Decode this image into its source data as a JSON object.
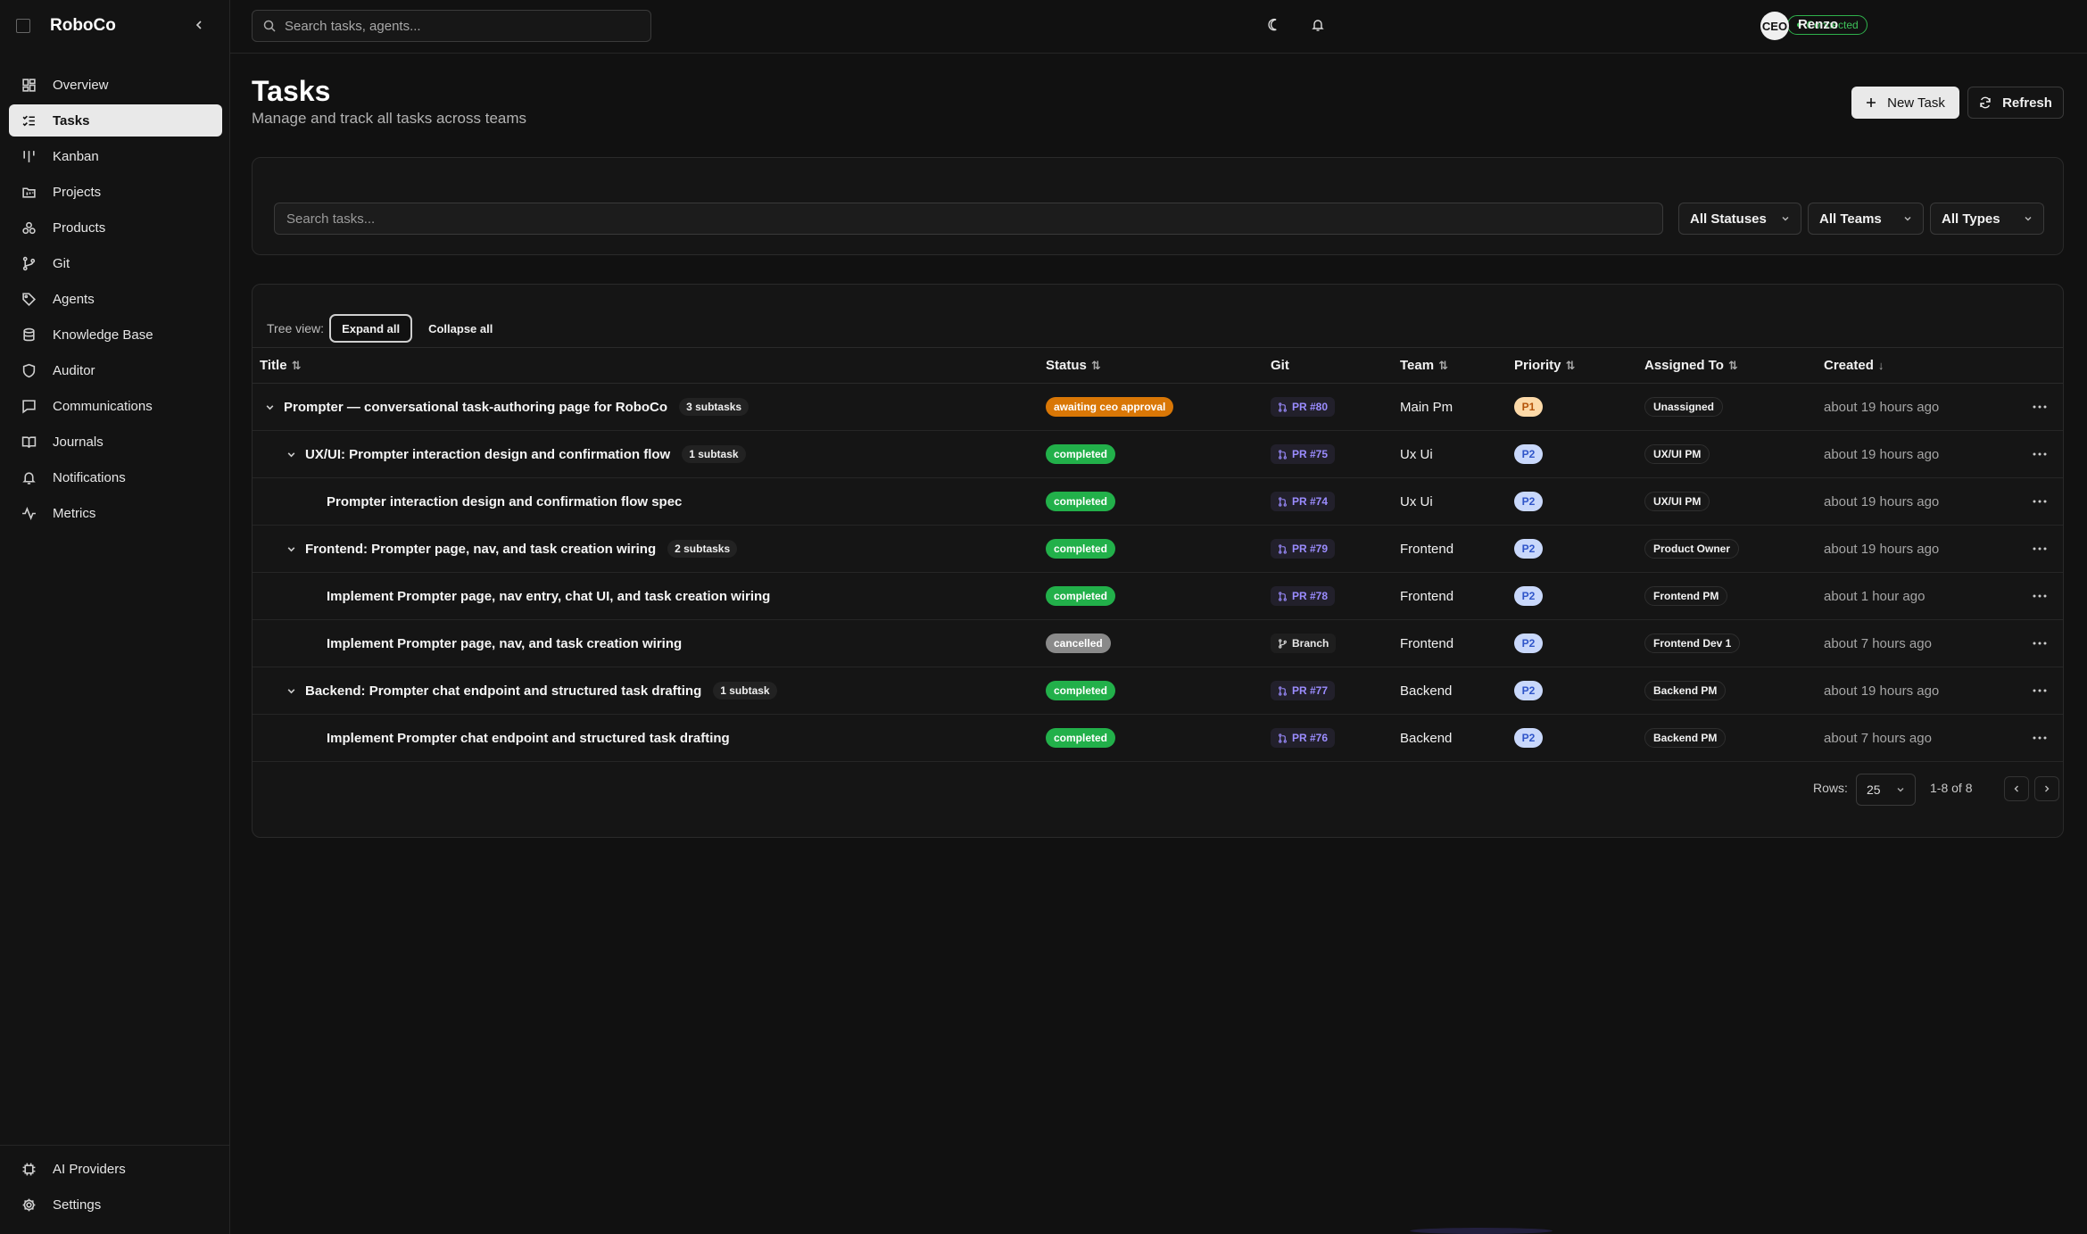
{
  "app": {
    "name": "RoboCo"
  },
  "sidebar": {
    "items": [
      {
        "label": "Overview",
        "icon": "grid-icon",
        "active": false
      },
      {
        "label": "Tasks",
        "icon": "list-checks-icon",
        "active": true
      },
      {
        "label": "Kanban",
        "icon": "kanban-icon",
        "active": false
      },
      {
        "label": "Projects",
        "icon": "folder-kanban-icon",
        "active": false
      },
      {
        "label": "Products",
        "icon": "boxes-icon",
        "active": false
      },
      {
        "label": "Git",
        "icon": "git-branch-icon",
        "active": false
      },
      {
        "label": "Agents",
        "icon": "tag-icon",
        "active": false
      },
      {
        "label": "Knowledge Base",
        "icon": "database-icon",
        "active": false
      },
      {
        "label": "Auditor",
        "icon": "shield-icon",
        "active": false
      },
      {
        "label": "Communications",
        "icon": "message-square-icon",
        "active": false
      },
      {
        "label": "Journals",
        "icon": "book-open-icon",
        "active": false
      },
      {
        "label": "Notifications",
        "icon": "bell-icon",
        "active": false
      },
      {
        "label": "Metrics",
        "icon": "activity-icon",
        "active": false
      }
    ],
    "bottom": [
      {
        "label": "AI Providers",
        "icon": "cpu-icon"
      },
      {
        "label": "Settings",
        "icon": "gear-icon"
      }
    ]
  },
  "header": {
    "search_placeholder": "Search tasks, agents...",
    "connection": "Connected",
    "avatar_initials": "CEO",
    "user_name": "Renzo"
  },
  "page": {
    "title": "Tasks",
    "subtitle": "Manage and track all tasks across teams",
    "new_task_label": "New Task",
    "refresh_label": "Refresh"
  },
  "filters": {
    "search_placeholder": "Search tasks...",
    "status": "All Statuses",
    "team": "All Teams",
    "type": "All Types"
  },
  "tree": {
    "label": "Tree view:",
    "expand": "Expand all",
    "collapse": "Collapse all"
  },
  "columns": {
    "title": "Title",
    "status": "Status",
    "git": "Git",
    "team": "Team",
    "priority": "Priority",
    "assigned": "Assigned To",
    "created": "Created"
  },
  "rows": [
    {
      "title": "Prompter — conversational task-authoring page for RoboCo",
      "subtasks": "3 subtasks",
      "status": "awaiting ceo approval",
      "git": "PR #80",
      "git_type": "pr",
      "team": "Main Pm",
      "priority": "P1",
      "assigned": "Unassigned",
      "created": "about 19 hours ago"
    },
    {
      "title": "UX/UI: Prompter interaction design and confirmation flow",
      "subtasks": "1 subtask",
      "status": "completed",
      "git": "PR #75",
      "git_type": "pr",
      "team": "Ux Ui",
      "priority": "P2",
      "assigned": "UX/UI PM",
      "created": "about 19 hours ago"
    },
    {
      "title": "Prompter interaction design and confirmation flow spec",
      "subtasks": "",
      "status": "completed",
      "git": "PR #74",
      "git_type": "pr",
      "team": "Ux Ui",
      "priority": "P2",
      "assigned": "UX/UI PM",
      "created": "about 19 hours ago"
    },
    {
      "title": "Frontend: Prompter page, nav, and task creation wiring",
      "subtasks": "2 subtasks",
      "status": "completed",
      "git": "PR #79",
      "git_type": "pr",
      "team": "Frontend",
      "priority": "P2",
      "assigned": "Product Owner",
      "created": "about 19 hours ago"
    },
    {
      "title": "Implement Prompter page, nav entry, chat UI, and task creation wiring",
      "subtasks": "",
      "status": "completed",
      "git": "PR #78",
      "git_type": "pr",
      "team": "Frontend",
      "priority": "P2",
      "assigned": "Frontend PM",
      "created": "about 1 hour ago"
    },
    {
      "title": "Implement Prompter page, nav, and task creation wiring",
      "subtasks": "",
      "status": "cancelled",
      "git": "Branch",
      "git_type": "branch",
      "team": "Frontend",
      "priority": "P2",
      "assigned": "Frontend Dev 1",
      "created": "about 7 hours ago"
    },
    {
      "title": "Backend: Prompter chat endpoint and structured task drafting",
      "subtasks": "1 subtask",
      "status": "completed",
      "git": "PR #77",
      "git_type": "pr",
      "team": "Backend",
      "priority": "P2",
      "assigned": "Backend PM",
      "created": "about 19 hours ago"
    },
    {
      "title": "Implement Prompter chat endpoint and structured task drafting",
      "subtasks": "",
      "status": "completed",
      "git": "PR #76",
      "git_type": "pr",
      "team": "Backend",
      "priority": "P2",
      "assigned": "Backend PM",
      "created": "about 7 hours ago"
    }
  ],
  "pagination": {
    "rows_label": "Rows:",
    "rows_value": "25",
    "range": "1-8 of 8"
  },
  "colors": {
    "awaiting": "#d97706",
    "completed": "#22b04a",
    "cancelled": "#8a8a8a",
    "p1_bg": "#fcd9a8",
    "p1_fg": "#b45309",
    "p2_bg": "#c9d8fb",
    "p2_fg": "#2f55c9"
  }
}
